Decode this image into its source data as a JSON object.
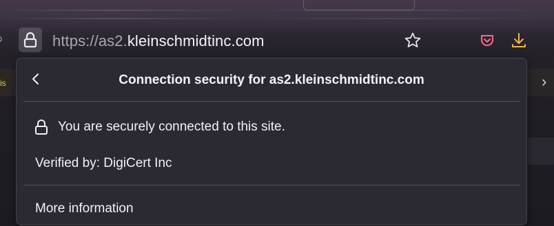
{
  "browser": {
    "url_scheme": "https://as2.",
    "url_host": "kleinschmidtinc.com",
    "icons": [
      "lock-icon",
      "star-icon",
      "pocket-icon",
      "download-icon"
    ]
  },
  "popup": {
    "title": "Connection security for as2.kleinschmidtinc.com",
    "back_icon": "chevron-left-icon",
    "secure_message": "You are securely connected to this site.",
    "verified_by": "Verified by: DigiCert Inc",
    "more_information": "More information"
  },
  "colors": {
    "panel_bg": "#2b2a33",
    "text": "#f2f1f5",
    "url_dim": "#a9a6b2"
  }
}
